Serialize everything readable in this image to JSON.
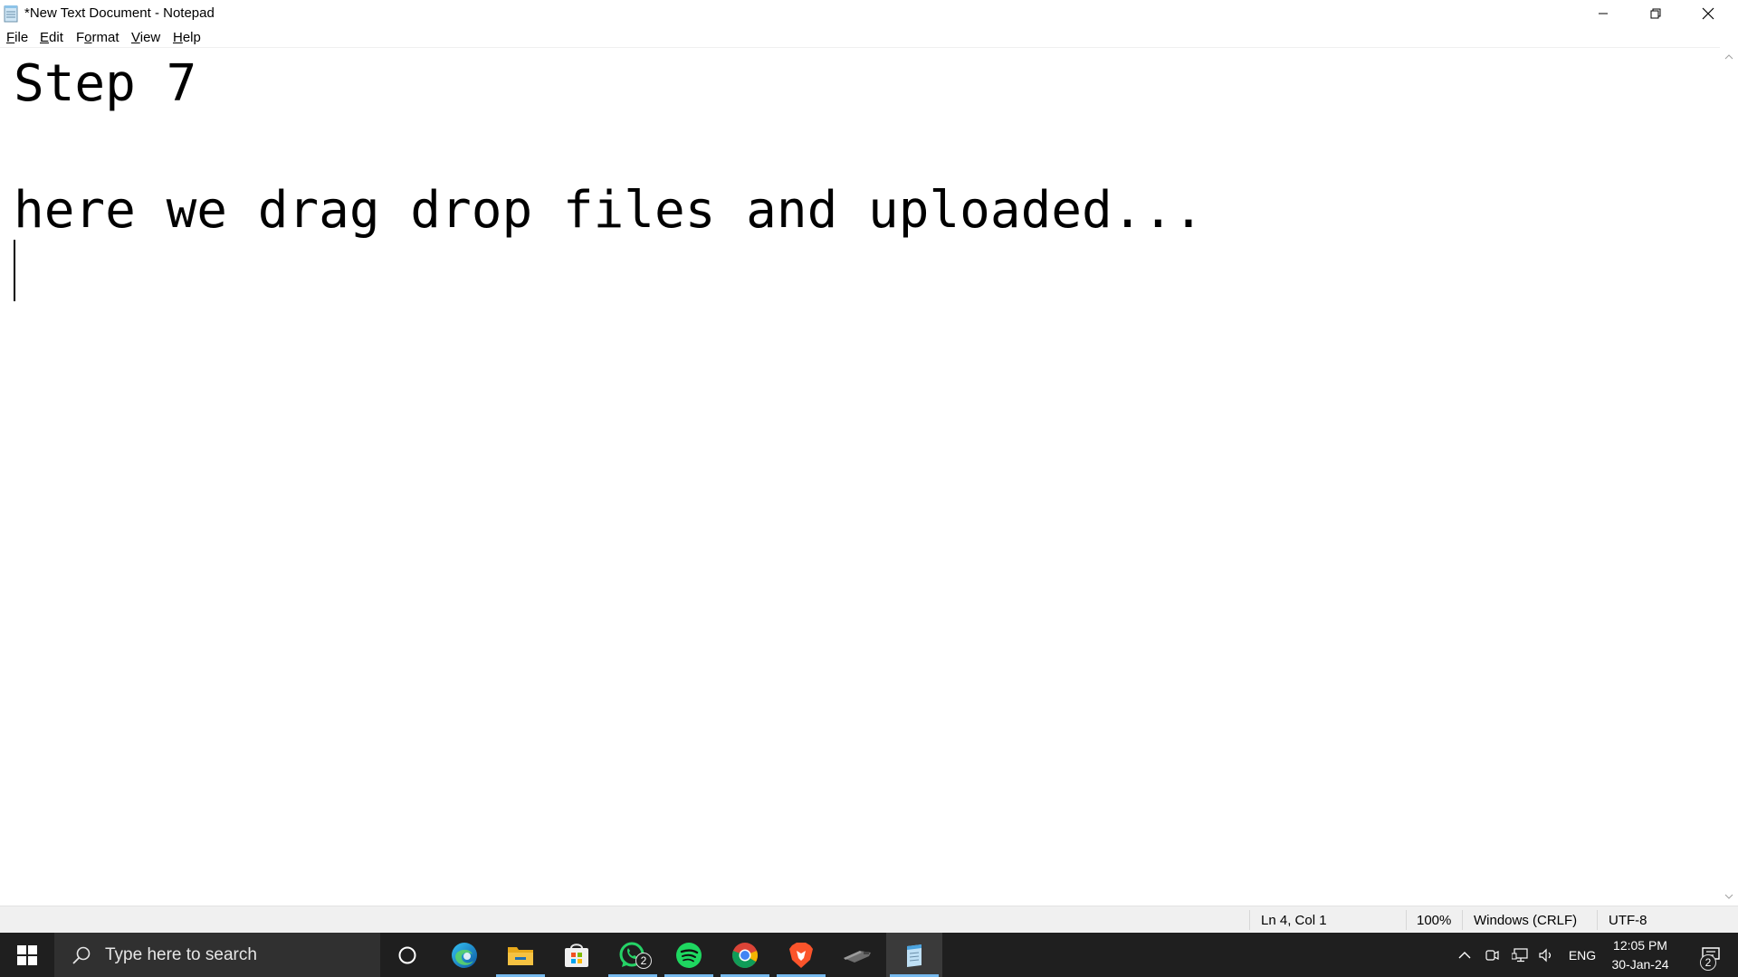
{
  "window": {
    "title": "*New Text Document - Notepad"
  },
  "menu": {
    "items": [
      {
        "label": "File",
        "mnemonic": "F",
        "rest": "ile"
      },
      {
        "label": "Edit",
        "mnemonic": "E",
        "rest": "dit"
      },
      {
        "label": "Format",
        "mnemonic": "o",
        "prefix": "F",
        "rest": "rmat"
      },
      {
        "label": "View",
        "mnemonic": "V",
        "rest": "iew"
      },
      {
        "label": "Help",
        "mnemonic": "H",
        "rest": "elp"
      }
    ]
  },
  "editor": {
    "lines": [
      "Step 7",
      "",
      "here we drag drop files and uploaded...",
      ""
    ]
  },
  "status": {
    "position": "Ln 4, Col 1",
    "zoom": "100%",
    "line_ending": "Windows (CRLF)",
    "encoding": "UTF-8"
  },
  "taskbar": {
    "search_placeholder": "Type here to search",
    "whatsapp_badge": "2",
    "notification_badge": "2",
    "icons": [
      "windows-start-icon",
      "cortana-icon",
      "edge-icon",
      "file-explorer-icon",
      "microsoft-store-icon",
      "whatsapp-icon",
      "spotify-icon",
      "chrome-icon",
      "brave-icon",
      "media-app-icon",
      "notepad-icon"
    ]
  },
  "tray": {
    "language": "ENG",
    "time": "12:05 PM",
    "date": "30-Jan-24"
  },
  "colors": {
    "taskbar_bg": "#1f1f1f",
    "active_underline": "#76b9ed",
    "spotify": "#1ed760",
    "whatsapp": "#25d366",
    "brave": "#fb542b",
    "edge": "#0c8ad3",
    "folder": "#f5c242"
  }
}
